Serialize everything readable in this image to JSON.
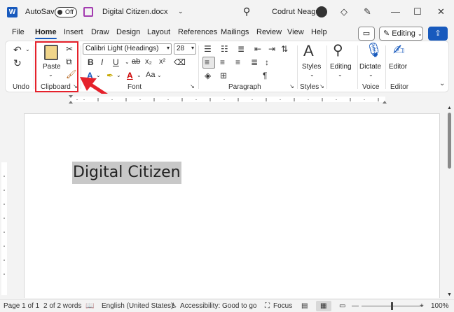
{
  "titlebar": {
    "autosave_label": "AutoSave",
    "autosave_state": "Off",
    "filename": "Digital Citizen.docx",
    "user": "Codrut Neagu",
    "app_icon": "word-icon"
  },
  "tabs": [
    "File",
    "Home",
    "Insert",
    "Draw",
    "Design",
    "Layout",
    "References",
    "Mailings",
    "Review",
    "View",
    "Help"
  ],
  "active_tab": "Home",
  "editing_label": "Editing",
  "ribbon": {
    "groups": {
      "undo": "Undo",
      "clipboard": "Clipboard",
      "font": "Font",
      "paragraph": "Paragraph",
      "styles": "Styles",
      "voice": "Voice",
      "editor": "Editor"
    },
    "paste_label": "Paste",
    "font_name": "Calibri Light (Headings)",
    "font_size": "28",
    "styles_label": "Styles",
    "editing_label": "Editing",
    "dictate_label": "Dictate",
    "editor_label": "Editor",
    "font_buttons": [
      "B",
      "I",
      "U",
      "ab",
      "x₂",
      "x²"
    ],
    "aa_label": "Aa",
    "font_color_a": "A"
  },
  "document": {
    "text": "Digital Citizen"
  },
  "status": {
    "page": "Page 1 of 1",
    "words": "2 of 2 words",
    "language": "English (United States)",
    "accessibility": "Accessibility: Good to go",
    "focus": "Focus",
    "zoom": "100%"
  },
  "colors": {
    "accent": "#185abd",
    "highlight_box": "#e5212b",
    "selection": "#c8c8c8"
  }
}
